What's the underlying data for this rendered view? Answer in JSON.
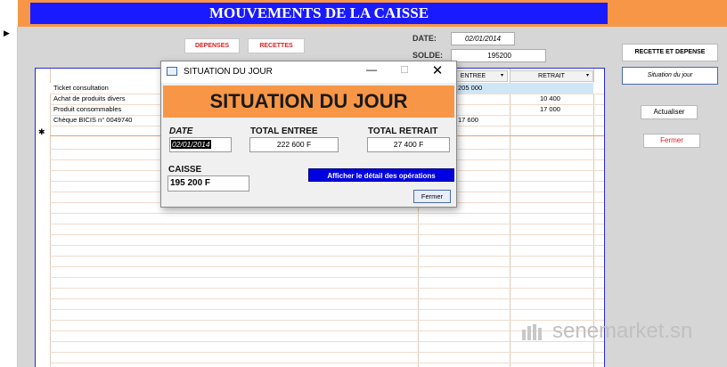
{
  "header": {
    "title": "MOUVEMENTS DE LA CAISSE"
  },
  "toolbar": {
    "depenses_label": "DEPENSES",
    "recettes_label": "RECETTES",
    "date_label": "DATE:",
    "date_value": "02/01/2014",
    "solde_label": "SOLDE:",
    "solde_value": "195200"
  },
  "table": {
    "columns": [
      {
        "label": "ENTREE"
      },
      {
        "label": "RETRAIT"
      }
    ],
    "rows": [
      {
        "description": "Ticket consultation",
        "entree": "205 000",
        "retrait": ""
      },
      {
        "description": "Achat de produits divers",
        "entree": "",
        "retrait": "10 400"
      },
      {
        "description": "Produit consommables",
        "entree": "",
        "retrait": "17 000"
      },
      {
        "description": "Chèque BICIS n° 0049740",
        "entree": "17 600",
        "retrait": ""
      }
    ],
    "new_record_marker": "✱"
  },
  "side_panel": {
    "recette_depense_label": "RECETTE ET DEPENSE",
    "situation_label": "Situation du jour",
    "actualiser_label": "Actualiser",
    "fermer_label": "Fermer"
  },
  "dialog": {
    "window_title": "SITUATION DU JOUR",
    "header": "SITUATION DU JOUR",
    "date_label": "DATE",
    "date_value": "02/01/2014",
    "total_entree_label": "TOTAL ENTREE",
    "total_entree_value": "222 600 F",
    "total_retrait_label": "TOTAL RETRAIT",
    "total_retrait_value": "27 400 F",
    "caisse_label": "CAISSE",
    "caisse_value": "195 200 F",
    "detail_button": "Afficher le détail des opérations",
    "fermer_button": "Fermer"
  },
  "watermark": {
    "text": "senemarket.sn"
  },
  "colors": {
    "accent_orange": "#f79646",
    "title_blue": "#1a1aff",
    "button_red": "#d62020"
  }
}
